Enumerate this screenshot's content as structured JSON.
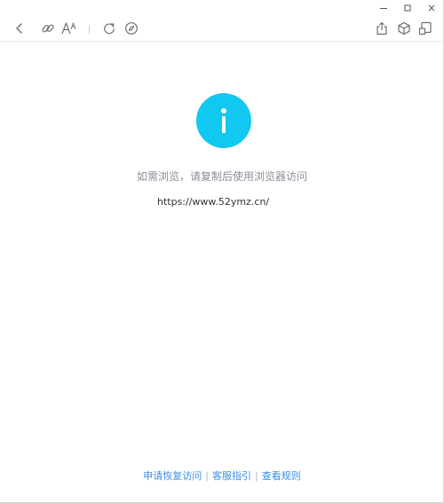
{
  "colors": {
    "accent": "#10c8f0",
    "link": "#3a8ee6",
    "message_text": "#8a8f99",
    "icon": "#6e6e6e"
  },
  "titlebar": {
    "icons": [
      "minimize-icon",
      "maximize-icon",
      "close-icon"
    ]
  },
  "toolbar": {
    "icons": [
      "back-arrow-icon",
      "link-icon",
      "font-size-icon",
      "refresh-icon",
      "compass-icon",
      "share-icon",
      "cube-icon",
      "window-icon"
    ]
  },
  "main": {
    "icon": "info-icon",
    "message": "如需浏览，请复制后使用浏览器访问",
    "url": "https://www.52ymz.cn/"
  },
  "footer": {
    "link_restore": "申请恢复访问",
    "link_guide": "客服指引",
    "link_rules": "查看规则",
    "divider": "|"
  }
}
